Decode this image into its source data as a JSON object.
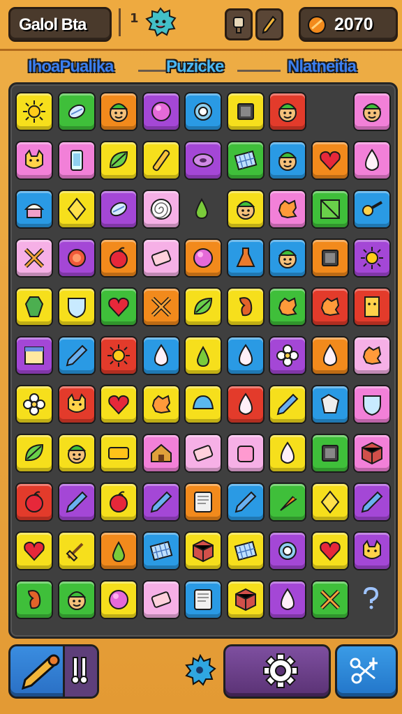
{
  "header": {
    "title": "Galol Bta",
    "level_prefix": "1",
    "score": "2070"
  },
  "tabs": [
    {
      "label": "IhoaPualika",
      "active": false
    },
    {
      "label": "Puzicke",
      "active": true
    },
    {
      "label": "Nlatneitia",
      "active": false
    }
  ],
  "colors": {
    "yellow": "#f6df1c",
    "green": "#3fbf3a",
    "orange": "#f28a1c",
    "purple": "#a447d6",
    "blue": "#2a9ae4",
    "red": "#e33b2b",
    "pink": "#f280d8",
    "lightpink": "#f6b0e6",
    "empty": "#3f3f3f"
  },
  "board": [
    [
      {
        "c": "yellow",
        "i": "sun-icon"
      },
      {
        "c": "green",
        "i": "candy-icon"
      },
      {
        "c": "orange",
        "i": "face-icon"
      },
      {
        "c": "purple",
        "i": "ball-icon"
      },
      {
        "c": "blue",
        "i": "robot-icon"
      },
      {
        "c": "yellow",
        "i": "frame-icon"
      },
      {
        "c": "red",
        "i": "face-icon"
      },
      {
        "c": "empty",
        "i": ""
      },
      {
        "c": "pink",
        "i": "face-icon"
      }
    ],
    [
      {
        "c": "pink",
        "i": "cat-icon"
      },
      {
        "c": "pink",
        "i": "phone-icon"
      },
      {
        "c": "yellow",
        "i": "leaf-icon"
      },
      {
        "c": "yellow",
        "i": "stick-icon"
      },
      {
        "c": "purple",
        "i": "disc-icon"
      },
      {
        "c": "green",
        "i": "grid-icon"
      },
      {
        "c": "blue",
        "i": "face-icon"
      },
      {
        "c": "orange",
        "i": "heart-icon"
      },
      {
        "c": "pink",
        "i": "drop-icon"
      }
    ],
    [
      {
        "c": "blue",
        "i": "cake-icon"
      },
      {
        "c": "yellow",
        "i": "gem-icon"
      },
      {
        "c": "purple",
        "i": "candy-icon"
      },
      {
        "c": "lightpink",
        "i": "spiral-icon"
      },
      {
        "c": "empty",
        "i": "pear-icon"
      },
      {
        "c": "yellow",
        "i": "face-icon"
      },
      {
        "c": "pink",
        "i": "splat-icon"
      },
      {
        "c": "green",
        "i": "square-icon"
      },
      {
        "c": "blue",
        "i": "key-icon"
      }
    ],
    [
      {
        "c": "lightpink",
        "i": "cross-icon"
      },
      {
        "c": "purple",
        "i": "burst-icon"
      },
      {
        "c": "orange",
        "i": "apple-icon"
      },
      {
        "c": "lightpink",
        "i": "eraser-icon"
      },
      {
        "c": "orange",
        "i": "ball-icon"
      },
      {
        "c": "blue",
        "i": "flask-icon"
      },
      {
        "c": "blue",
        "i": "face-icon"
      },
      {
        "c": "orange",
        "i": "frame-icon"
      },
      {
        "c": "purple",
        "i": "sun-icon"
      }
    ],
    [
      {
        "c": "yellow",
        "i": "coffin-icon"
      },
      {
        "c": "yellow",
        "i": "shield-icon"
      },
      {
        "c": "green",
        "i": "heart-icon"
      },
      {
        "c": "orange",
        "i": "cross-icon"
      },
      {
        "c": "yellow",
        "i": "leaf-icon"
      },
      {
        "c": "yellow",
        "i": "bean-icon"
      },
      {
        "c": "green",
        "i": "splat-icon"
      },
      {
        "c": "red",
        "i": "splat-icon"
      },
      {
        "c": "red",
        "i": "box-icon"
      }
    ],
    [
      {
        "c": "purple",
        "i": "book-icon"
      },
      {
        "c": "blue",
        "i": "pen-icon"
      },
      {
        "c": "red",
        "i": "sun-icon"
      },
      {
        "c": "blue",
        "i": "drop-icon"
      },
      {
        "c": "yellow",
        "i": "pear-icon"
      },
      {
        "c": "blue",
        "i": "drop-icon"
      },
      {
        "c": "purple",
        "i": "flower-icon"
      },
      {
        "c": "orange",
        "i": "drop-icon"
      },
      {
        "c": "lightpink",
        "i": "splat-icon"
      }
    ],
    [
      {
        "c": "yellow",
        "i": "flower-icon"
      },
      {
        "c": "red",
        "i": "cat-icon"
      },
      {
        "c": "yellow",
        "i": "heart-icon"
      },
      {
        "c": "yellow",
        "i": "splat-icon"
      },
      {
        "c": "yellow",
        "i": "cap-icon"
      },
      {
        "c": "red",
        "i": "drop-icon"
      },
      {
        "c": "yellow",
        "i": "pen-icon"
      },
      {
        "c": "blue",
        "i": "crystal-icon"
      },
      {
        "c": "pink",
        "i": "shield-icon"
      }
    ],
    [
      {
        "c": "yellow",
        "i": "leaf-icon"
      },
      {
        "c": "yellow",
        "i": "face-icon"
      },
      {
        "c": "yellow",
        "i": "bar-icon"
      },
      {
        "c": "pink",
        "i": "house-icon"
      },
      {
        "c": "lightpink",
        "i": "eraser-icon"
      },
      {
        "c": "lightpink",
        "i": "jar-icon"
      },
      {
        "c": "yellow",
        "i": "drop-icon"
      },
      {
        "c": "green",
        "i": "frame-icon"
      },
      {
        "c": "pink",
        "i": "cube-icon"
      }
    ],
    [
      {
        "c": "red",
        "i": "apple-icon"
      },
      {
        "c": "purple",
        "i": "pen-icon"
      },
      {
        "c": "yellow",
        "i": "apple-icon"
      },
      {
        "c": "purple",
        "i": "pen-icon"
      },
      {
        "c": "orange",
        "i": "tablet-icon"
      },
      {
        "c": "blue",
        "i": "pen-icon"
      },
      {
        "c": "green",
        "i": "carrot-icon"
      },
      {
        "c": "yellow",
        "i": "gem-icon"
      },
      {
        "c": "purple",
        "i": "pen-icon"
      }
    ],
    [
      {
        "c": "yellow",
        "i": "heart-icon"
      },
      {
        "c": "yellow",
        "i": "broom-icon"
      },
      {
        "c": "orange",
        "i": "pear-icon"
      },
      {
        "c": "blue",
        "i": "grid-icon"
      },
      {
        "c": "yellow",
        "i": "cube-icon"
      },
      {
        "c": "yellow",
        "i": "grid-icon"
      },
      {
        "c": "purple",
        "i": "robot-icon"
      },
      {
        "c": "yellow",
        "i": "heart-icon"
      },
      {
        "c": "purple",
        "i": "cat-icon"
      }
    ],
    [
      {
        "c": "green",
        "i": "bean-icon"
      },
      {
        "c": "green",
        "i": "face-icon"
      },
      {
        "c": "yellow",
        "i": "ball-icon"
      },
      {
        "c": "lightpink",
        "i": "eraser-icon"
      },
      {
        "c": "blue",
        "i": "tablet-icon"
      },
      {
        "c": "yellow",
        "i": "cube-icon"
      },
      {
        "c": "purple",
        "i": "drop-icon"
      },
      {
        "c": "green",
        "i": "cross-icon"
      },
      {
        "c": "empty",
        "i": "question-icon"
      }
    ]
  ]
}
